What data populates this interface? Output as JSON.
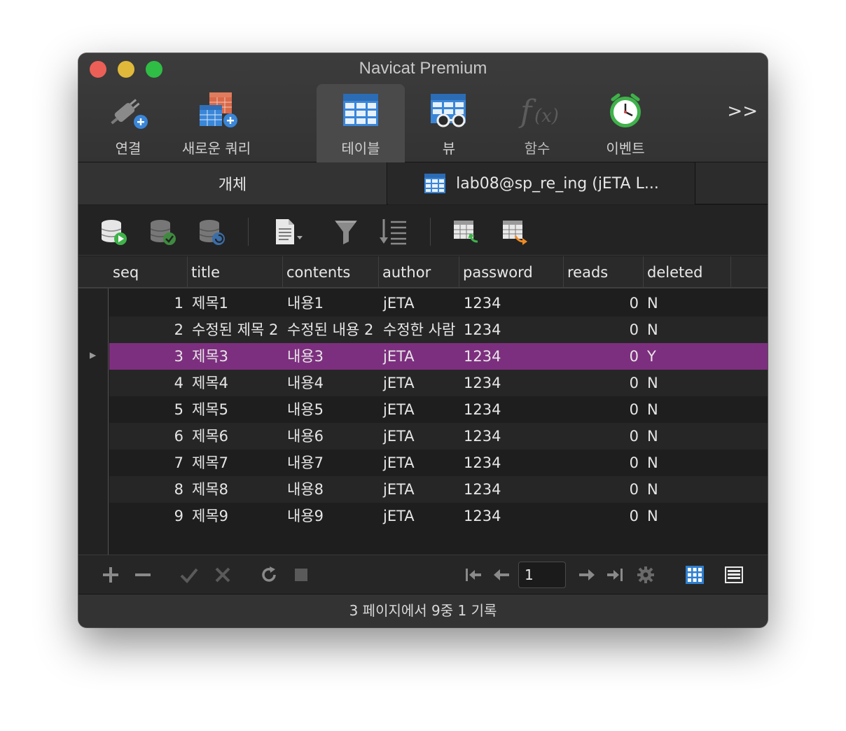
{
  "window": {
    "title": "Navicat Premium"
  },
  "toolbar": {
    "items": [
      {
        "label": "연결",
        "icon": "connection-plug-icon"
      },
      {
        "label": "새로운 쿼리",
        "icon": "new-query-icon"
      },
      {
        "label": "테이블",
        "icon": "table-icon",
        "active": true
      },
      {
        "label": "뷰",
        "icon": "view-icon"
      },
      {
        "label": "함수",
        "icon": "function-icon"
      },
      {
        "label": "이벤트",
        "icon": "event-clock-icon"
      }
    ],
    "more_label": ">>"
  },
  "tabs": {
    "objects_label": "개체",
    "table_label": "lab08@sp_re_ing (jETA L..."
  },
  "grid": {
    "columns": [
      "seq",
      "title",
      "contents",
      "author",
      "password",
      "reads",
      "deleted"
    ],
    "selected_row": 2,
    "rows": [
      [
        "1",
        "제목1",
        "내용1",
        "jETA",
        "1234",
        "0",
        "N"
      ],
      [
        "2",
        "수정된 제목 2",
        "수정된 내용 2",
        "수정한 사람",
        "1234",
        "0",
        "N"
      ],
      [
        "3",
        "제목3",
        "내용3",
        "jETA",
        "1234",
        "0",
        "Y"
      ],
      [
        "4",
        "제목4",
        "내용4",
        "jETA",
        "1234",
        "0",
        "N"
      ],
      [
        "5",
        "제목5",
        "내용5",
        "jETA",
        "1234",
        "0",
        "N"
      ],
      [
        "6",
        "제목6",
        "내용6",
        "jETA",
        "1234",
        "0",
        "N"
      ],
      [
        "7",
        "제목7",
        "내용7",
        "jETA",
        "1234",
        "0",
        "N"
      ],
      [
        "8",
        "제목8",
        "내용8",
        "jETA",
        "1234",
        "0",
        "N"
      ],
      [
        "9",
        "제목9",
        "내용9",
        "jETA",
        "1234",
        "0",
        "N"
      ]
    ]
  },
  "pagination": {
    "page_value": "1"
  },
  "status": {
    "text": "3 페이지에서 9중 1 기록"
  },
  "colors": {
    "selection": "#7d2f7f",
    "accent_blue": "#2f7fd0"
  }
}
